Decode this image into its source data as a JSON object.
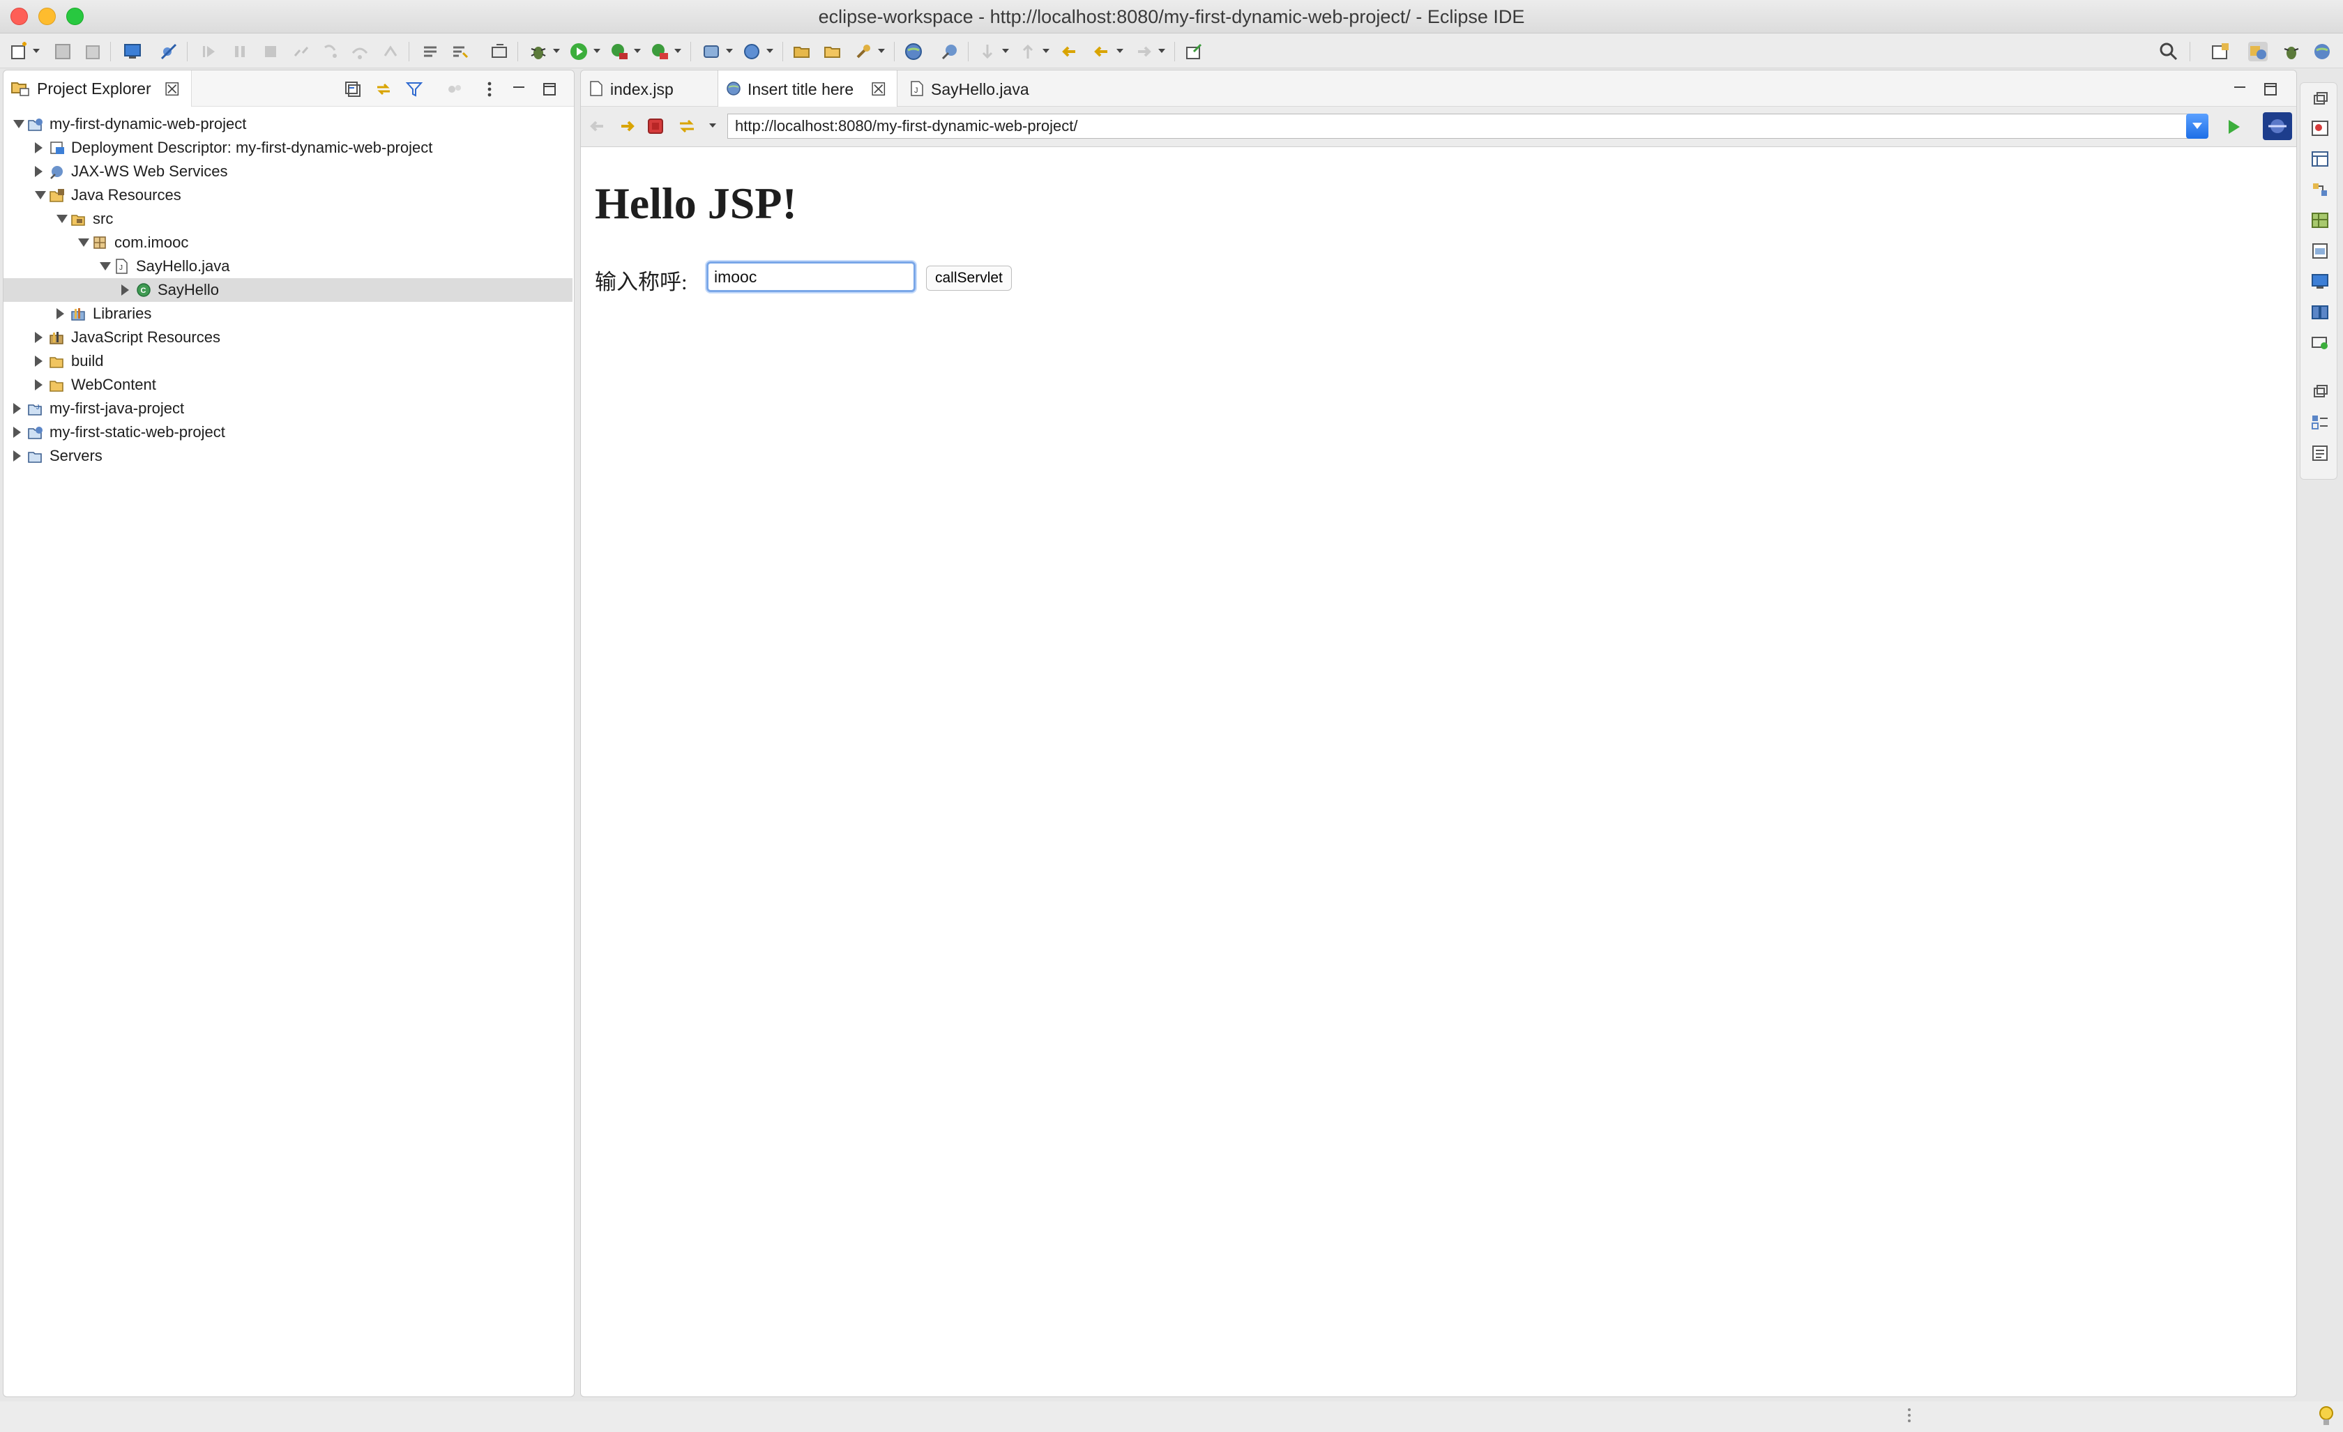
{
  "window": {
    "title": "eclipse-workspace - http://localhost:8080/my-first-dynamic-web-project/ - Eclipse IDE"
  },
  "project_explorer": {
    "tab_label": "Project Explorer",
    "tree": [
      {
        "label": "my-first-dynamic-web-project",
        "depth": 0,
        "state": "expanded",
        "icon": "web-project-icon"
      },
      {
        "label": "Deployment Descriptor: my-first-dynamic-web-project",
        "depth": 1,
        "state": "collapsed",
        "icon": "deployment-descriptor-icon"
      },
      {
        "label": "JAX-WS Web Services",
        "depth": 1,
        "state": "collapsed",
        "icon": "web-services-icon"
      },
      {
        "label": "Java Resources",
        "depth": 1,
        "state": "expanded",
        "icon": "java-resources-icon"
      },
      {
        "label": "src",
        "depth": 2,
        "state": "expanded",
        "icon": "source-folder-icon"
      },
      {
        "label": "com.imooc",
        "depth": 3,
        "state": "expanded",
        "icon": "package-icon"
      },
      {
        "label": "SayHello.java",
        "depth": 4,
        "state": "expanded",
        "icon": "java-file-icon"
      },
      {
        "label": "SayHello",
        "depth": 5,
        "state": "collapsed",
        "icon": "class-icon",
        "selected": true
      },
      {
        "label": "Libraries",
        "depth": 2,
        "state": "collapsed",
        "icon": "libraries-icon"
      },
      {
        "label": "JavaScript Resources",
        "depth": 1,
        "state": "collapsed",
        "icon": "javascript-resources-icon"
      },
      {
        "label": "build",
        "depth": 1,
        "state": "collapsed",
        "icon": "folder-icon"
      },
      {
        "label": "WebContent",
        "depth": 1,
        "state": "collapsed",
        "icon": "folder-icon"
      },
      {
        "label": "my-first-java-project",
        "depth": 0,
        "state": "collapsed",
        "icon": "java-project-icon"
      },
      {
        "label": "my-first-static-web-project",
        "depth": 0,
        "state": "collapsed",
        "icon": "web-project-icon"
      },
      {
        "label": "Servers",
        "depth": 0,
        "state": "collapsed",
        "icon": "servers-folder-icon"
      }
    ]
  },
  "editor": {
    "tabs": [
      {
        "label": "index.jsp",
        "icon": "jsp-file-icon"
      },
      {
        "label": "Insert title here",
        "icon": "globe-icon",
        "active": true
      },
      {
        "label": "SayHello.java",
        "icon": "java-file-icon"
      }
    ],
    "browser": {
      "url": "http://localhost:8080/my-first-dynamic-web-project/"
    },
    "page": {
      "heading": "Hello JSP!",
      "field_label": "输入称呼:",
      "field_value": "imooc",
      "button_label": "callServlet"
    }
  },
  "colors": {
    "accent": "#1e6fe6",
    "selection": "#dcdcdc",
    "run_green": "#3cae3c",
    "stop_red": "#d63b3b"
  }
}
